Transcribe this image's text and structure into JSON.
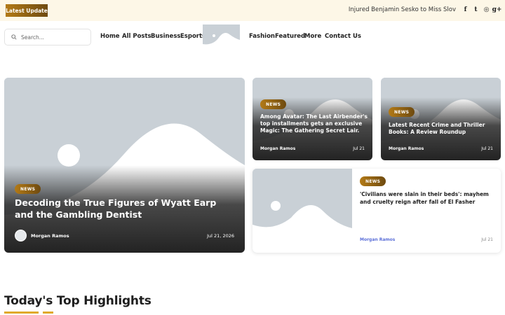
{
  "topbar": {
    "latest_label": "Latest Update",
    "ticker_text": "Injured Benjamin Sesko to Miss Slov",
    "socials": [
      {
        "icon": "facebook-icon",
        "glyph": "f"
      },
      {
        "icon": "twitter-icon",
        "glyph": "t"
      },
      {
        "icon": "instagram-icon",
        "glyph": "◎"
      },
      {
        "icon": "google-plus-icon",
        "glyph": "g+"
      }
    ]
  },
  "search": {
    "placeholder": "Search..."
  },
  "nav": {
    "home": "Home",
    "all_posts": "All Posts",
    "business": "Business",
    "esports": "Esports",
    "fashion": "Fashion",
    "featured": "Featured",
    "more": "More",
    "contact": "Contact Us"
  },
  "hero": {
    "badge": "NEWS",
    "title": "Decoding the True Figures of Wyatt Earp and the Gambling Dentist",
    "author": "Morgan Ramos",
    "date": "Jul 21, 2026"
  },
  "card1": {
    "badge": "NEWS",
    "title": "Among Avatar: The Last Airbender's top installments gets an exclusive Magic: The Gathering Secret Lair.",
    "author": "Morgan Ramos",
    "date": "Jul 21"
  },
  "card2": {
    "badge": "NEWS",
    "title": "Latest Recent Crime and Thriller Books: A Review Roundup",
    "author": "Morgan Ramos",
    "date": "Jul 21"
  },
  "card3": {
    "badge": "NEWS",
    "title": "'Civilians were slain in their beds': mayhem and cruelty reign after fall of El Fasher",
    "author": "Morgan Ramos",
    "date": "Jul 21"
  },
  "highlights": {
    "title": "Today's Top Highlights"
  },
  "colors": {
    "accent": "#e0a92a",
    "badge_start": "#b37a16",
    "badge_end": "#6e4a10",
    "placeholder_bg": "#c9d0d6",
    "author_link": "#5b6fd8"
  }
}
